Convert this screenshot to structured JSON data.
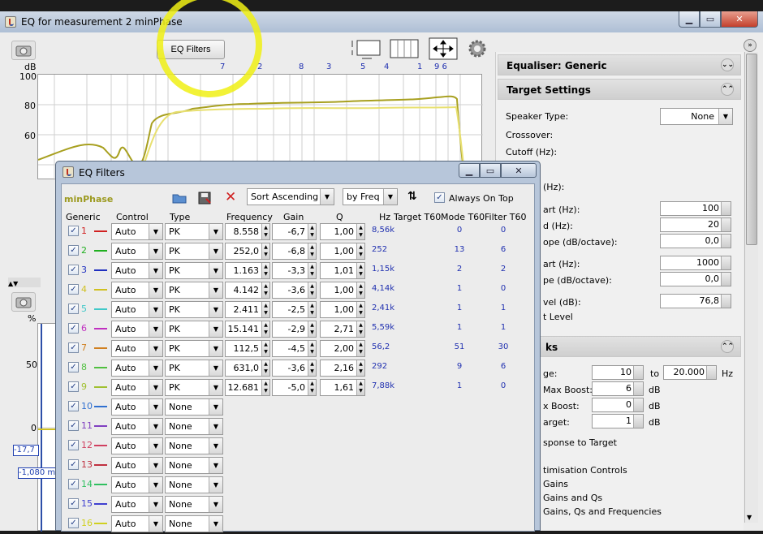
{
  "window": {
    "title": "EQ for measurement 2 minPhase"
  },
  "toolbar": {
    "eq_filters_label": "EQ Filters"
  },
  "peak_labels": [
    "7",
    "2",
    "8",
    "3",
    "5",
    "4",
    "1",
    "9 6"
  ],
  "plot_top": {
    "ylabel": "dB",
    "ticks": [
      "100",
      "80",
      "60"
    ]
  },
  "plot_bottom": {
    "ylabel": "%",
    "ticks": [
      "50",
      "0"
    ],
    "readout1": "-17,7",
    "readout2": "-1,080 m"
  },
  "right_panel": {
    "equaliser_header": "Equaliser: Generic",
    "target_header": "Target Settings",
    "speaker_type_label": "Speaker Type:",
    "speaker_type_value": "None",
    "crossover_label": "Crossover:",
    "cutoff_label": "Cutoff (Hz):",
    "hz_label": "(Hz):",
    "start_label": "art (Hz):",
    "start_value": "100",
    "end_label": "d (Hz):",
    "end_value": "20",
    "slope1_label": "ope (dB/octave):",
    "slope1_value": "0,0",
    "start2_label": "art (Hz):",
    "start2_value": "1000",
    "slope2_label": "pe (dB/octave):",
    "slope2_value": "0,0",
    "level_label": "vel (dB):",
    "level_value": "76,8",
    "tlevel_label": "t Level",
    "tracks_header": "ks",
    "range_label": "ge:",
    "range_from": "10",
    "range_to_label": "to",
    "range_to": "20.000",
    "range_unit": "Hz",
    "maxboost_label": "Max Boost:",
    "maxboost_value": "6",
    "xboost_label": "x Boost:",
    "xboost_value": "0",
    "target_label": "arget:",
    "target_value": "1",
    "db": "dB",
    "response_label": "sponse to Target",
    "optim_label": "timisation Controls",
    "gains_label": "Gains",
    "gainsq_label": "Gains and Qs",
    "gainsqf_label": "Gains, Qs and Frequencies"
  },
  "dialog": {
    "title": "EQ Filters",
    "name": "minPhase",
    "sort_value": "Sort Ascending",
    "by_value": "by Freq",
    "always_on_top": "Always On Top",
    "headers": {
      "generic": "Generic",
      "control": "Control",
      "type": "Type",
      "frequency": "Frequency",
      "gain": "Gain",
      "q": "Q",
      "hz": "Hz",
      "target_t60": "Target T60",
      "mode_t60": "Mode T60",
      "filter_t60": "Filter T60"
    },
    "rows": [
      {
        "n": "1",
        "color": "#d02020",
        "control": "Auto",
        "type": "PK",
        "freq": "8.558",
        "gain": "-6,7",
        "q": "1,00",
        "hz": "8,56k",
        "mode": "0",
        "filter": "0"
      },
      {
        "n": "2",
        "color": "#20b020",
        "control": "Auto",
        "type": "PK",
        "freq": "252,0",
        "gain": "-6,8",
        "q": "1,00",
        "hz": "252",
        "mode": "13",
        "filter": "6"
      },
      {
        "n": "3",
        "color": "#2030c0",
        "control": "Auto",
        "type": "PK",
        "freq": "1.163",
        "gain": "-3,3",
        "q": "1,01",
        "hz": "1,15k",
        "mode": "2",
        "filter": "2"
      },
      {
        "n": "4",
        "color": "#d0c020",
        "control": "Auto",
        "type": "PK",
        "freq": "4.142",
        "gain": "-3,6",
        "q": "1,00",
        "hz": "4,14k",
        "mode": "1",
        "filter": "0"
      },
      {
        "n": "5",
        "color": "#40c8c8",
        "control": "Auto",
        "type": "PK",
        "freq": "2.411",
        "gain": "-2,5",
        "q": "1,00",
        "hz": "2,41k",
        "mode": "1",
        "filter": "1"
      },
      {
        "n": "6",
        "color": "#c030c0",
        "control": "Auto",
        "type": "PK",
        "freq": "15.141",
        "gain": "-2,9",
        "q": "2,71",
        "hz": "5,59k",
        "mode": "1",
        "filter": "1"
      },
      {
        "n": "7",
        "color": "#d08020",
        "control": "Auto",
        "type": "PK",
        "freq": "112,5",
        "gain": "-4,5",
        "q": "2,00",
        "hz": "56,2",
        "mode": "51",
        "filter": "30"
      },
      {
        "n": "8",
        "color": "#50c040",
        "control": "Auto",
        "type": "PK",
        "freq": "631,0",
        "gain": "-3,6",
        "q": "2,16",
        "hz": "292",
        "mode": "9",
        "filter": "6"
      },
      {
        "n": "9",
        "color": "#a0c030",
        "control": "Auto",
        "type": "PK",
        "freq": "12.681",
        "gain": "-5,0",
        "q": "1,61",
        "hz": "7,88k",
        "mode": "1",
        "filter": "0"
      },
      {
        "n": "10",
        "color": "#3070d0",
        "control": "Auto",
        "type": "None"
      },
      {
        "n": "11",
        "color": "#8040c0",
        "control": "Auto",
        "type": "None"
      },
      {
        "n": "12",
        "color": "#d04060",
        "control": "Auto",
        "type": "None"
      },
      {
        "n": "13",
        "color": "#c03040",
        "control": "Auto",
        "type": "None"
      },
      {
        "n": "14",
        "color": "#30c060",
        "control": "Auto",
        "type": "None"
      },
      {
        "n": "15",
        "color": "#4040d0",
        "control": "Auto",
        "type": "None"
      },
      {
        "n": "16",
        "color": "#d0d020",
        "control": "Auto",
        "type": "None"
      }
    ]
  }
}
